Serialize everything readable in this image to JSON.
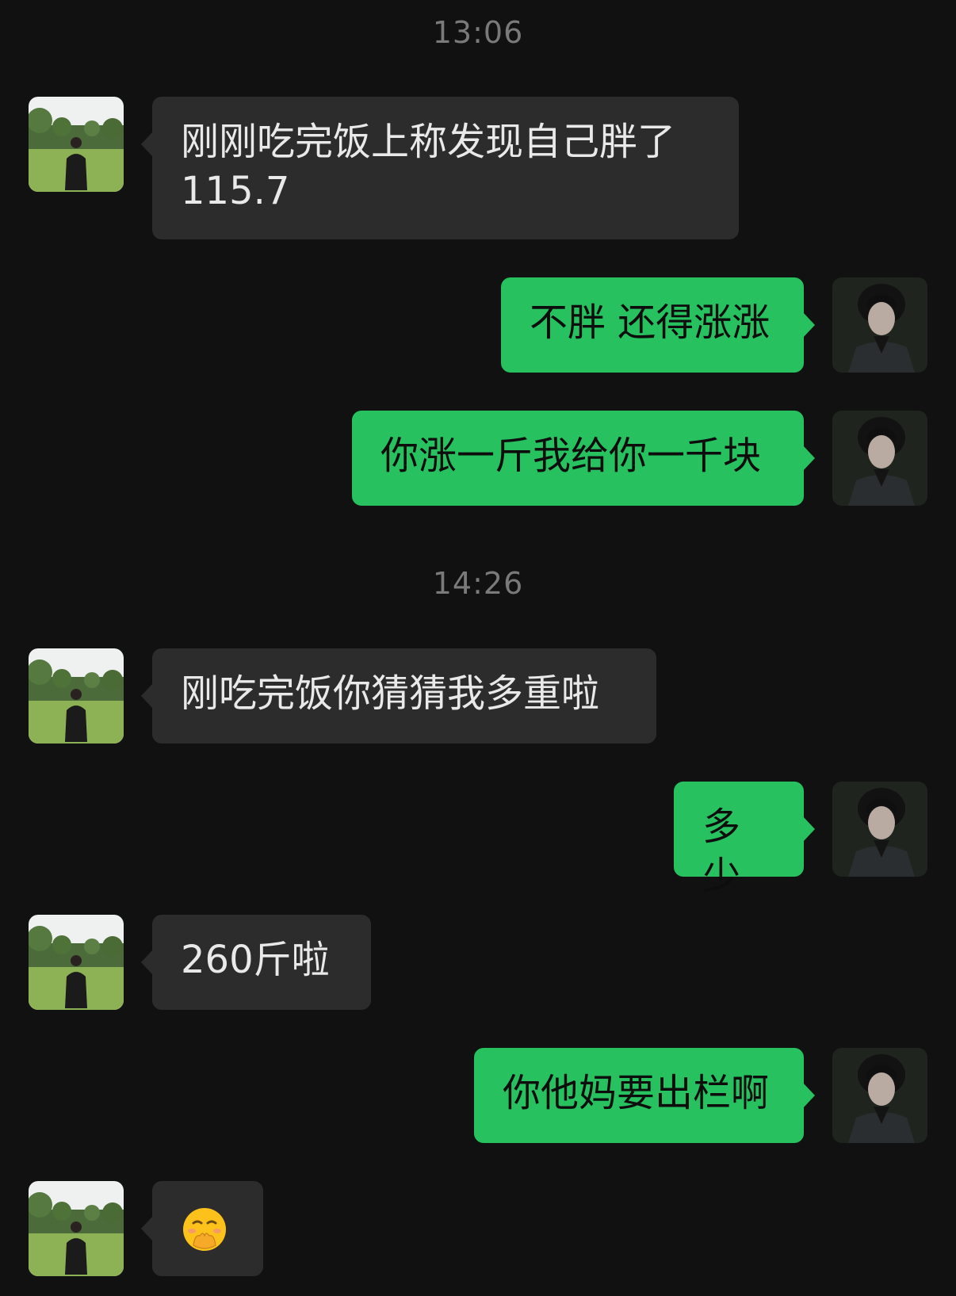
{
  "colors": {
    "background": "#111111",
    "incoming_bubble": "#2c2c2c",
    "outgoing_bubble": "#27c160",
    "timestamp_text": "#7a7a7a"
  },
  "timestamps": [
    "13:06",
    "14:26"
  ],
  "messages": [
    {
      "side": "incoming",
      "text": "刚刚吃完饭上称发现自己胖了115.7"
    },
    {
      "side": "outgoing",
      "text": "不胖 还得涨涨"
    },
    {
      "side": "outgoing",
      "text": "你涨一斤我给你一千块"
    },
    {
      "side": "incoming",
      "text": "刚吃完饭你猜猜我多重啦"
    },
    {
      "side": "outgoing",
      "text": "多少"
    },
    {
      "side": "incoming",
      "text": "260斤啦"
    },
    {
      "side": "outgoing",
      "text": "你他妈要出栏啊"
    },
    {
      "side": "incoming",
      "emoji": "face-with-hand-over-mouth-emoji"
    }
  ],
  "avatars": {
    "incoming": "avatar-person-in-field",
    "outgoing": "avatar-dark-haired-man"
  }
}
